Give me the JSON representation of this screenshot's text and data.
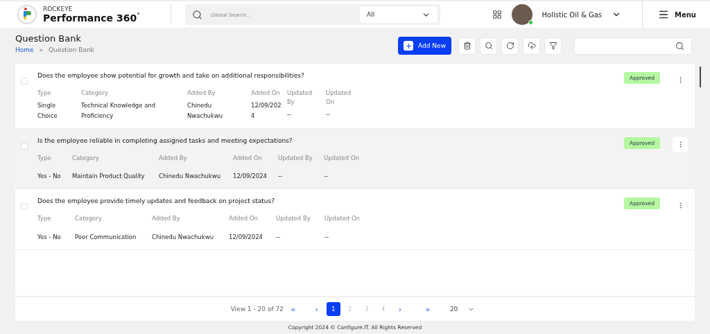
{
  "brand": {
    "top": "ROCKEYE",
    "name": "Performance 360",
    "mark": "°"
  },
  "search": {
    "placeholder": "Global Search...",
    "scope": "All"
  },
  "user": {
    "company": "Holistic Oil & Gas",
    "online": true
  },
  "menu": {
    "label": "Menu"
  },
  "page": {
    "title": "Question Bank",
    "separator": "»",
    "breadcrumb": [
      {
        "label": "Home",
        "kind": "link"
      },
      {
        "label": "Question Bank",
        "kind": "current"
      }
    ]
  },
  "toolbar": {
    "add_label": "Add New"
  },
  "questions": [
    {
      "question": "Does the employee show potential for growth and take on additional responsibilities?",
      "status": "Approved",
      "checked": false,
      "highlighted": false,
      "kind": "narrow",
      "fields": [
        {
          "label": "Type",
          "value": "Single Choice"
        },
        {
          "label": "Category",
          "value": "Technical Knowledge and Proficiency"
        },
        {
          "label": "Added By",
          "value": "Chinedu Nwachukwu"
        },
        {
          "label": "Added On",
          "value": "12/09/2024"
        },
        {
          "label": "Updated By",
          "value": "--"
        },
        {
          "label": "Updated On",
          "value": "--"
        }
      ]
    },
    {
      "question": "Is the employee reliable in completing assigned tasks and meeting expectations?",
      "status": "Approved",
      "checked": false,
      "highlighted": true,
      "kind": "wide",
      "fields": [
        {
          "label": "Type",
          "value": "Yes - No"
        },
        {
          "label": "Category",
          "value": "Maintain Product Quality"
        },
        {
          "label": "Added By",
          "value": "Chinedu Nwachukwu"
        },
        {
          "label": "Added On",
          "value": "12/09/2024"
        },
        {
          "label": "Updated By",
          "value": "--"
        },
        {
          "label": "Updated On",
          "value": "--"
        }
      ]
    },
    {
      "question": "Does the employee provide timely updates and feedback on project status?",
      "status": "Approved",
      "checked": false,
      "highlighted": false,
      "kind": "wide",
      "fields": [
        {
          "label": "Type",
          "value": "Yes - No"
        },
        {
          "label": "Category",
          "value": "Poor Communication"
        },
        {
          "label": "Added By",
          "value": "Chinedu Nwachukwu"
        },
        {
          "label": "Added On",
          "value": "12/09/2024"
        },
        {
          "label": "Updated By",
          "value": "--"
        },
        {
          "label": "Updated On",
          "value": "--"
        }
      ]
    }
  ],
  "pagination": {
    "summary": "View 1 - 20 of 72",
    "first": "«",
    "prev": "‹",
    "next": "›",
    "last": "»",
    "pages": [
      {
        "label": "1",
        "selected": true
      },
      {
        "label": "2",
        "selected": false
      },
      {
        "label": "3",
        "selected": false
      },
      {
        "label": "4",
        "selected": false
      }
    ],
    "page_size": "20"
  },
  "footer": "Copyright 2024 © Configure.IT. All Rights Reserved"
}
